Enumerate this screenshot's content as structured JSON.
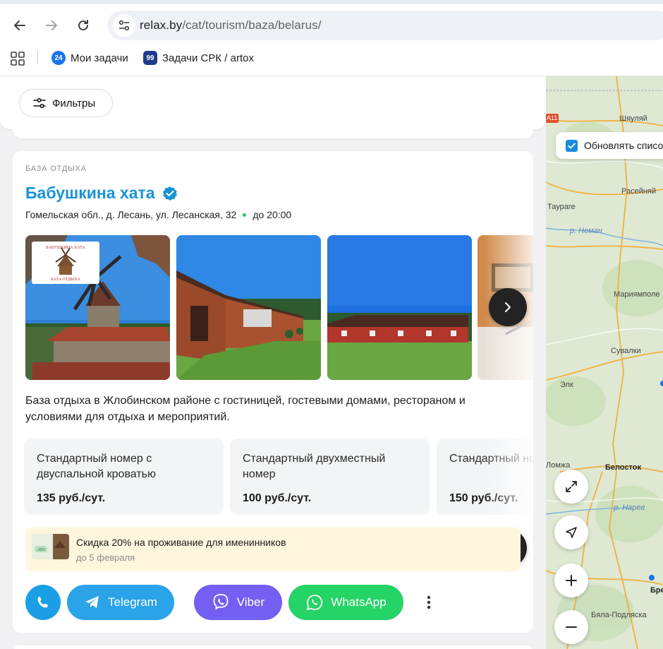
{
  "browser": {
    "url_domain": "relax.by",
    "url_path": "/cat/tourism/baza/belarus/",
    "bookmarks": [
      {
        "label": "Мои задачи",
        "favicon_text": "24",
        "favicon_color": "#1a73e8"
      },
      {
        "label": "Задачи СРК / artox",
        "favicon_text": "99",
        "favicon_color": "#1e3a8a"
      }
    ]
  },
  "filters": {
    "label": "Фильтры"
  },
  "card": {
    "category": "БАЗА ОТДЫХА",
    "title": "Бабушкина хата",
    "address": "Гомельская обл., д. Лесань, ул. Лесанская, 32",
    "hours": "до 20:00",
    "logo_text_top": "БАБУШКИНА ХАТА",
    "logo_text_bottom": "БАЗА ОТДЫХА",
    "description": "База отдыха в Жлобинском районе с гостиницей, гостевыми домами, рестораном и условиями для отдыха и мероприятий.",
    "rooms": [
      {
        "name": "Стандартный номер с двуспальной кроватью",
        "price": "135 руб./сут."
      },
      {
        "name": "Стандартный двухместный номер",
        "price": "100 руб./сут."
      },
      {
        "name": "Стандартный номер",
        "price": "150 руб./сут."
      }
    ],
    "promo": {
      "title": "Скидка 20% на проживание для именинников",
      "subtitle": "до 5 февраля",
      "thumb_badge": "-20%"
    },
    "actions": {
      "telegram": "Telegram",
      "viber": "Viber",
      "whatsapp": "WhatsApp"
    }
  },
  "map": {
    "update_label": "Обновлять список",
    "labels": {
      "shiaulyai": "Шяуляй",
      "raseiniai": "Расейняй",
      "taurage": "Таураге",
      "neman": "р. Неман",
      "marijampole": "Мариямполе",
      "suvalki": "Сувалки",
      "elk": "Элк",
      "lomzha": "Ломжа",
      "belostok": "Белосток",
      "narev": "р. Нарев",
      "brest": "Брест",
      "bela_podlaska": "Бяла-Подляска",
      "road": "A11"
    }
  },
  "colors": {
    "accent": "#1a93d6",
    "telegram": "#2aa3e8",
    "viber": "#7360f2",
    "whatsapp": "#25d366",
    "phone": "#1a9fe6"
  }
}
